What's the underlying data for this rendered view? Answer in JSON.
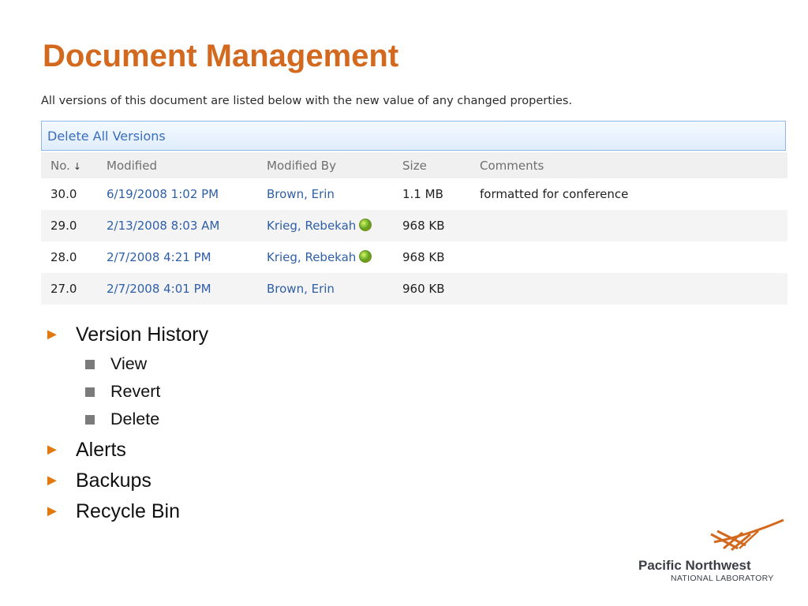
{
  "slide": {
    "title": "Document Management"
  },
  "screenshot": {
    "description": "All versions of this document are listed below with the new value of any changed properties.",
    "delete_all_label": "Delete All Versions",
    "columns": {
      "no": "No.",
      "modified": "Modified",
      "modified_by": "Modified By",
      "size": "Size",
      "comments": "Comments"
    },
    "sort_icon": "down-arrow-icon",
    "rows": [
      {
        "no": "30.0",
        "modified": "6/19/2008 1:02 PM",
        "modified_by": "Brown, Erin",
        "presence": false,
        "size": "1.1 MB",
        "comments": "formatted for conference"
      },
      {
        "no": "29.0",
        "modified": "2/13/2008 8:03 AM",
        "modified_by": "Krieg, Rebekah",
        "presence": true,
        "size": "968 KB",
        "comments": ""
      },
      {
        "no": "28.0",
        "modified": "2/7/2008 4:21 PM",
        "modified_by": "Krieg, Rebekah",
        "presence": true,
        "size": "968 KB",
        "comments": ""
      },
      {
        "no": "27.0",
        "modified": "2/7/2008 4:01 PM",
        "modified_by": "Brown, Erin",
        "presence": false,
        "size": "960 KB",
        "comments": ""
      }
    ]
  },
  "bullets": [
    {
      "label": "Version History",
      "sub": [
        "View",
        "Revert",
        "Delete"
      ]
    },
    {
      "label": "Alerts",
      "sub": []
    },
    {
      "label": "Backups",
      "sub": []
    },
    {
      "label": "Recycle Bin",
      "sub": []
    }
  ],
  "logo": {
    "name": "Pacific Northwest",
    "subtitle": "NATIONAL LABORATORY"
  },
  "colors": {
    "title": "#d2691e",
    "bullet": "#e07a10",
    "link": "#2f5fa8"
  }
}
